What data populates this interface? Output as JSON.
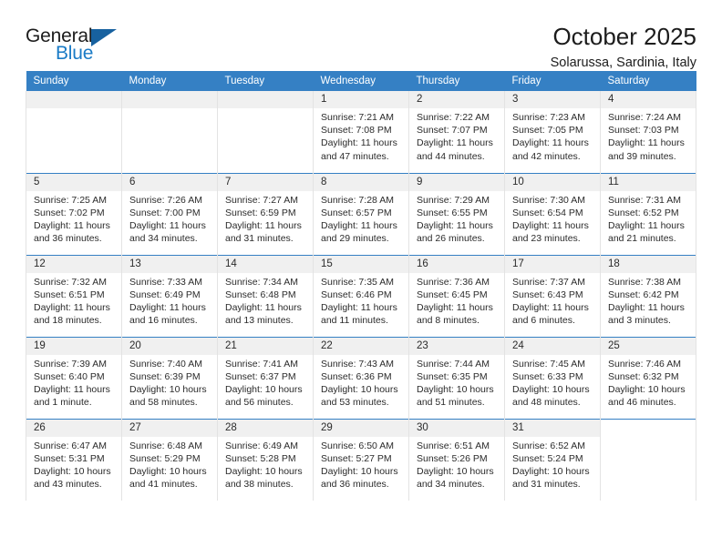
{
  "logo": {
    "word_top": "General",
    "word_bottom": "Blue",
    "accent_color": "#17619f",
    "blue_text_color": "#1a7bc6"
  },
  "header": {
    "title": "October 2025",
    "subtitle": "Solarussa, Sardinia, Italy"
  },
  "calendar": {
    "header_background": "#3580c4",
    "daynum_background": "#f0f0f0",
    "weekday_headers": [
      "Sunday",
      "Monday",
      "Tuesday",
      "Wednesday",
      "Thursday",
      "Friday",
      "Saturday"
    ],
    "weeks": [
      [
        {
          "day": "",
          "empty": true
        },
        {
          "day": "",
          "empty": true
        },
        {
          "day": "",
          "empty": true
        },
        {
          "day": "1",
          "sunrise": "Sunrise: 7:21 AM",
          "sunset": "Sunset: 7:08 PM",
          "daylight_1": "Daylight: 11 hours",
          "daylight_2": "and 47 minutes."
        },
        {
          "day": "2",
          "sunrise": "Sunrise: 7:22 AM",
          "sunset": "Sunset: 7:07 PM",
          "daylight_1": "Daylight: 11 hours",
          "daylight_2": "and 44 minutes."
        },
        {
          "day": "3",
          "sunrise": "Sunrise: 7:23 AM",
          "sunset": "Sunset: 7:05 PM",
          "daylight_1": "Daylight: 11 hours",
          "daylight_2": "and 42 minutes."
        },
        {
          "day": "4",
          "sunrise": "Sunrise: 7:24 AM",
          "sunset": "Sunset: 7:03 PM",
          "daylight_1": "Daylight: 11 hours",
          "daylight_2": "and 39 minutes."
        }
      ],
      [
        {
          "day": "5",
          "sunrise": "Sunrise: 7:25 AM",
          "sunset": "Sunset: 7:02 PM",
          "daylight_1": "Daylight: 11 hours",
          "daylight_2": "and 36 minutes."
        },
        {
          "day": "6",
          "sunrise": "Sunrise: 7:26 AM",
          "sunset": "Sunset: 7:00 PM",
          "daylight_1": "Daylight: 11 hours",
          "daylight_2": "and 34 minutes."
        },
        {
          "day": "7",
          "sunrise": "Sunrise: 7:27 AM",
          "sunset": "Sunset: 6:59 PM",
          "daylight_1": "Daylight: 11 hours",
          "daylight_2": "and 31 minutes."
        },
        {
          "day": "8",
          "sunrise": "Sunrise: 7:28 AM",
          "sunset": "Sunset: 6:57 PM",
          "daylight_1": "Daylight: 11 hours",
          "daylight_2": "and 29 minutes."
        },
        {
          "day": "9",
          "sunrise": "Sunrise: 7:29 AM",
          "sunset": "Sunset: 6:55 PM",
          "daylight_1": "Daylight: 11 hours",
          "daylight_2": "and 26 minutes."
        },
        {
          "day": "10",
          "sunrise": "Sunrise: 7:30 AM",
          "sunset": "Sunset: 6:54 PM",
          "daylight_1": "Daylight: 11 hours",
          "daylight_2": "and 23 minutes."
        },
        {
          "day": "11",
          "sunrise": "Sunrise: 7:31 AM",
          "sunset": "Sunset: 6:52 PM",
          "daylight_1": "Daylight: 11 hours",
          "daylight_2": "and 21 minutes."
        }
      ],
      [
        {
          "day": "12",
          "sunrise": "Sunrise: 7:32 AM",
          "sunset": "Sunset: 6:51 PM",
          "daylight_1": "Daylight: 11 hours",
          "daylight_2": "and 18 minutes."
        },
        {
          "day": "13",
          "sunrise": "Sunrise: 7:33 AM",
          "sunset": "Sunset: 6:49 PM",
          "daylight_1": "Daylight: 11 hours",
          "daylight_2": "and 16 minutes."
        },
        {
          "day": "14",
          "sunrise": "Sunrise: 7:34 AM",
          "sunset": "Sunset: 6:48 PM",
          "daylight_1": "Daylight: 11 hours",
          "daylight_2": "and 13 minutes."
        },
        {
          "day": "15",
          "sunrise": "Sunrise: 7:35 AM",
          "sunset": "Sunset: 6:46 PM",
          "daylight_1": "Daylight: 11 hours",
          "daylight_2": "and 11 minutes."
        },
        {
          "day": "16",
          "sunrise": "Sunrise: 7:36 AM",
          "sunset": "Sunset: 6:45 PM",
          "daylight_1": "Daylight: 11 hours",
          "daylight_2": "and 8 minutes."
        },
        {
          "day": "17",
          "sunrise": "Sunrise: 7:37 AM",
          "sunset": "Sunset: 6:43 PM",
          "daylight_1": "Daylight: 11 hours",
          "daylight_2": "and 6 minutes."
        },
        {
          "day": "18",
          "sunrise": "Sunrise: 7:38 AM",
          "sunset": "Sunset: 6:42 PM",
          "daylight_1": "Daylight: 11 hours",
          "daylight_2": "and 3 minutes."
        }
      ],
      [
        {
          "day": "19",
          "sunrise": "Sunrise: 7:39 AM",
          "sunset": "Sunset: 6:40 PM",
          "daylight_1": "Daylight: 11 hours",
          "daylight_2": "and 1 minute."
        },
        {
          "day": "20",
          "sunrise": "Sunrise: 7:40 AM",
          "sunset": "Sunset: 6:39 PM",
          "daylight_1": "Daylight: 10 hours",
          "daylight_2": "and 58 minutes."
        },
        {
          "day": "21",
          "sunrise": "Sunrise: 7:41 AM",
          "sunset": "Sunset: 6:37 PM",
          "daylight_1": "Daylight: 10 hours",
          "daylight_2": "and 56 minutes."
        },
        {
          "day": "22",
          "sunrise": "Sunrise: 7:43 AM",
          "sunset": "Sunset: 6:36 PM",
          "daylight_1": "Daylight: 10 hours",
          "daylight_2": "and 53 minutes."
        },
        {
          "day": "23",
          "sunrise": "Sunrise: 7:44 AM",
          "sunset": "Sunset: 6:35 PM",
          "daylight_1": "Daylight: 10 hours",
          "daylight_2": "and 51 minutes."
        },
        {
          "day": "24",
          "sunrise": "Sunrise: 7:45 AM",
          "sunset": "Sunset: 6:33 PM",
          "daylight_1": "Daylight: 10 hours",
          "daylight_2": "and 48 minutes."
        },
        {
          "day": "25",
          "sunrise": "Sunrise: 7:46 AM",
          "sunset": "Sunset: 6:32 PM",
          "daylight_1": "Daylight: 10 hours",
          "daylight_2": "and 46 minutes."
        }
      ],
      [
        {
          "day": "26",
          "sunrise": "Sunrise: 6:47 AM",
          "sunset": "Sunset: 5:31 PM",
          "daylight_1": "Daylight: 10 hours",
          "daylight_2": "and 43 minutes."
        },
        {
          "day": "27",
          "sunrise": "Sunrise: 6:48 AM",
          "sunset": "Sunset: 5:29 PM",
          "daylight_1": "Daylight: 10 hours",
          "daylight_2": "and 41 minutes."
        },
        {
          "day": "28",
          "sunrise": "Sunrise: 6:49 AM",
          "sunset": "Sunset: 5:28 PM",
          "daylight_1": "Daylight: 10 hours",
          "daylight_2": "and 38 minutes."
        },
        {
          "day": "29",
          "sunrise": "Sunrise: 6:50 AM",
          "sunset": "Sunset: 5:27 PM",
          "daylight_1": "Daylight: 10 hours",
          "daylight_2": "and 36 minutes."
        },
        {
          "day": "30",
          "sunrise": "Sunrise: 6:51 AM",
          "sunset": "Sunset: 5:26 PM",
          "daylight_1": "Daylight: 10 hours",
          "daylight_2": "and 34 minutes."
        },
        {
          "day": "31",
          "sunrise": "Sunrise: 6:52 AM",
          "sunset": "Sunset: 5:24 PM",
          "daylight_1": "Daylight: 10 hours",
          "daylight_2": "and 31 minutes."
        },
        {
          "day": "",
          "void": true
        }
      ]
    ]
  }
}
